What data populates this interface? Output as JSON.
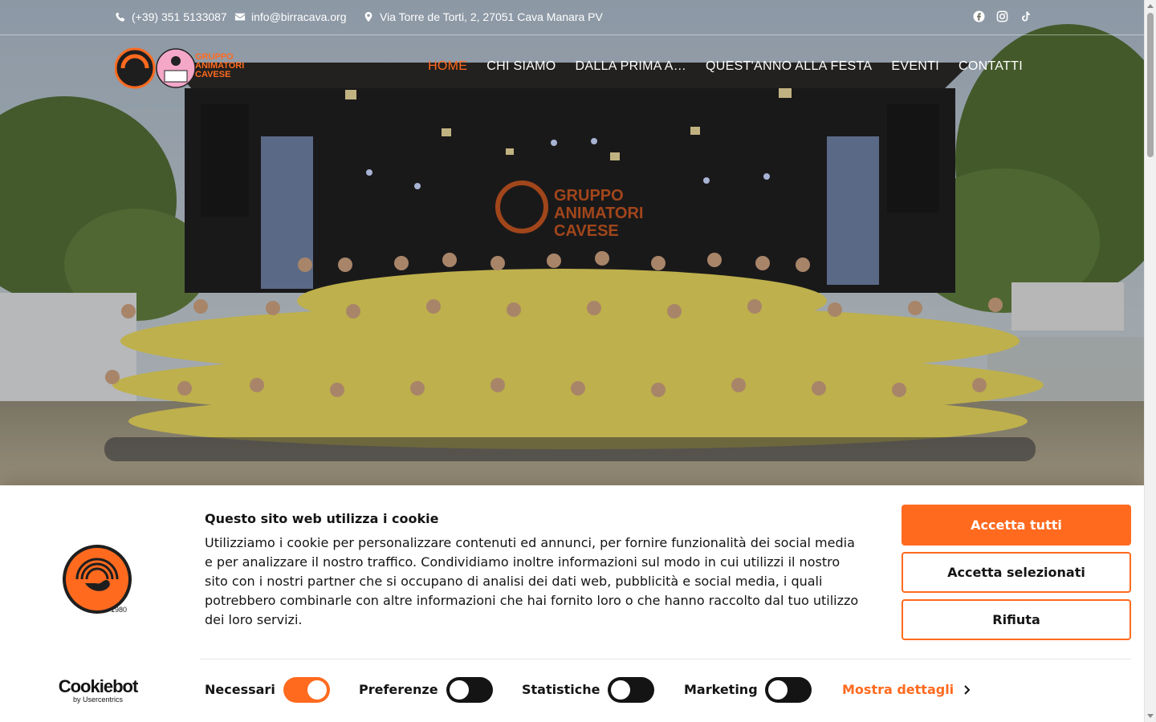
{
  "topbar": {
    "phone": "(+39) 351 5133087",
    "email": "info@birracava.org",
    "address": "Via Torre de Torti, 2, 27051 Cava Manara PV",
    "social_icons": [
      "facebook-icon",
      "instagram-icon",
      "tiktok-icon"
    ]
  },
  "nav": {
    "logo_text": [
      "GRUPPO",
      "ANIMATORI",
      "CAVESE"
    ],
    "items": [
      {
        "label": "HOME",
        "active": true
      },
      {
        "label": "CHI SIAMO",
        "active": false
      },
      {
        "label": "DALLA PRIMA A…",
        "active": false
      },
      {
        "label": "QUEST'ANNO ALLA FESTA",
        "active": false
      },
      {
        "label": "EVENTI",
        "active": false
      },
      {
        "label": "CONTATTI",
        "active": false
      }
    ]
  },
  "hero": {
    "image_description_icon": "group-photo-stage"
  },
  "cookie": {
    "title": "Questo sito web utilizza i cookie",
    "description": "Utilizziamo i cookie per personalizzare contenuti ed annunci, per fornire funzionalità dei social media e per analizzare il nostro traffico. Condividiamo inoltre informazioni sul modo in cui utilizzi il nostro sito con i nostri partner che si occupano di analisi dei dati web, pubblicità e social media, i quali potrebbero combinarle con altre informazioni che hai fornito loro o che hanno raccolto dal tuo utilizzo dei loro servizi.",
    "buttons": {
      "accept_all": "Accetta tutti",
      "accept_selected": "Accetta selezionati",
      "deny": "Rifiuta"
    },
    "toggles": [
      {
        "label": "Necessari",
        "on": true
      },
      {
        "label": "Preferenze",
        "on": false
      },
      {
        "label": "Statistiche",
        "on": false
      },
      {
        "label": "Marketing",
        "on": false
      }
    ],
    "show_details": "Mostra dettagli",
    "powered_by": {
      "brand": "Cookiebot",
      "sub": "by Usercentrics"
    }
  },
  "colors": {
    "accent": "#ff6a1f",
    "text_dark": "#141414",
    "toggle_off": "#141414"
  }
}
